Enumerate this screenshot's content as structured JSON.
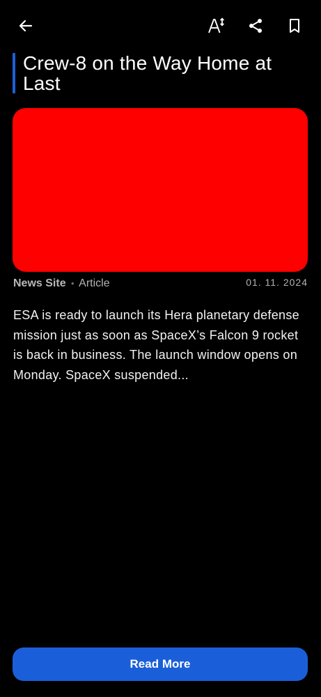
{
  "toolbar": {
    "back_icon": "arrow-left-icon",
    "text_size_icon": "text-size-icon",
    "share_icon": "share-icon",
    "bookmark_icon": "bookmark-outline-icon"
  },
  "article": {
    "title": "Crew-8 on the Way Home at Last",
    "image_placeholder_color": "#ff0000",
    "news_site": "News Site",
    "separator": "•",
    "type": "Article",
    "date": "01. 11. 2024",
    "summary": "ESA is ready to launch its Hera planetary defense mission just as soon as SpaceX’s Falcon 9 rocket is back in business. The launch window opens on Monday. SpaceX suspended..."
  },
  "actions": {
    "read_more_label": "Read More"
  },
  "colors": {
    "background": "#000000",
    "accent": "#1e5fd8",
    "button": "#1a5fd9"
  }
}
